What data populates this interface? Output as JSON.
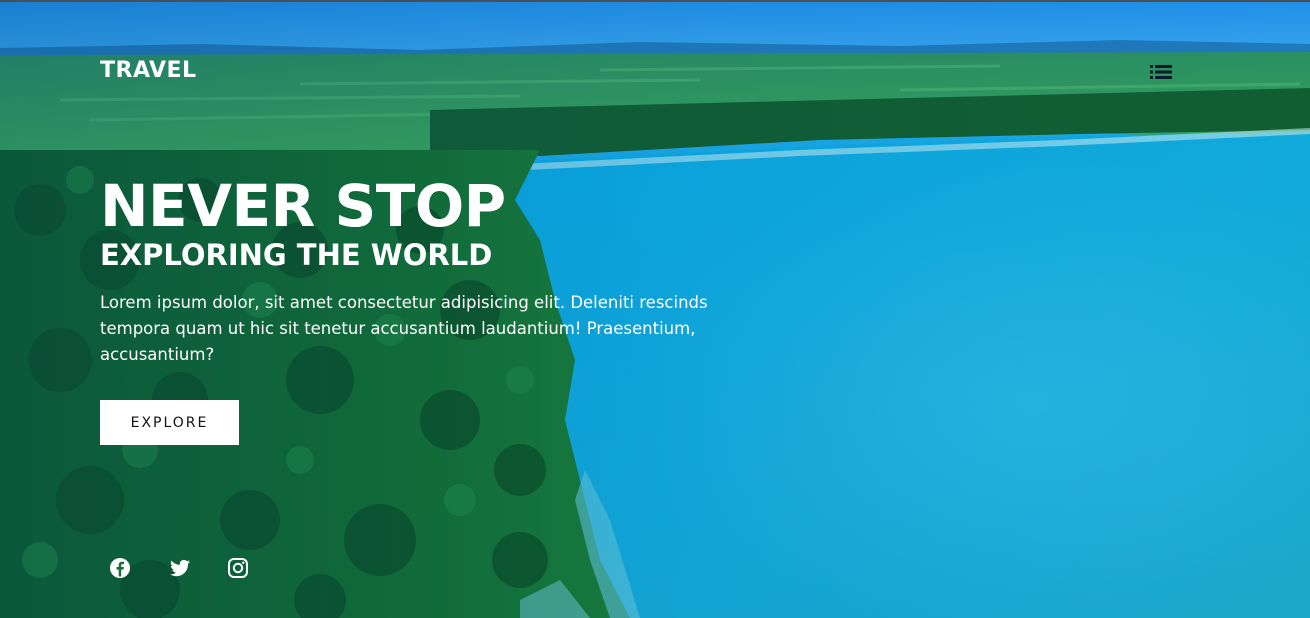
{
  "nav": {
    "brand": "TRAVEL",
    "menu_icon": "list-icon"
  },
  "hero": {
    "title": "NEVER STOP",
    "subtitle": "EXPLORING THE WORLD",
    "description": "Lorem ipsum dolor, sit amet consectetur adipisicing elit. Deleniti rescinds tempora quam ut hic sit tenetur accusantium laudantium! Praesentium, accusantium?",
    "button_label": "EXPLORE",
    "background": "aerial-coastline-photo"
  },
  "social": [
    {
      "name": "facebook",
      "icon": "facebook-icon"
    },
    {
      "name": "twitter",
      "icon": "twitter-icon"
    },
    {
      "name": "instagram",
      "icon": "instagram-icon"
    }
  ],
  "colors": {
    "sky": "#2a93ea",
    "water": "#12a9d9",
    "forest": "#0f6a32",
    "field": "#2fa25a",
    "button_bg": "#ffffff",
    "text": "#ffffff"
  }
}
